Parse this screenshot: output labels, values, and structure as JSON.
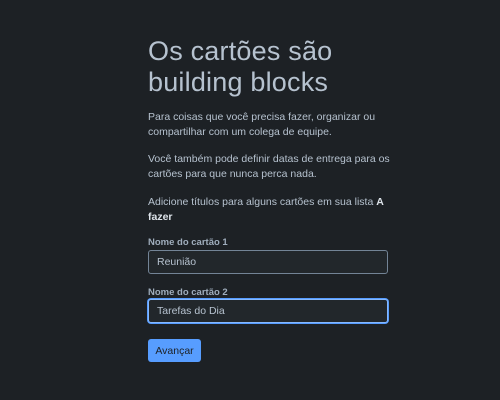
{
  "heading": "Os cartões são building blocks",
  "paragraphs": {
    "p1": "Para coisas que você precisa fazer, organizar ou compartilhar com um colega de equipe.",
    "p2": "Você também pode definir datas de entrega para os cartões para que nunca perca nada.",
    "p3_text": "Adicione títulos para alguns cartões em sua lista ",
    "p3_strong": "A fazer"
  },
  "fields": [
    {
      "label": "Nome do cartão 1",
      "value": "Reunião",
      "focused": false
    },
    {
      "label": "Nome do cartão 2",
      "value": "Tarefas do Dia",
      "focused": true
    }
  ],
  "button": {
    "label": "Avançar"
  },
  "colors": {
    "background": "#1d2125",
    "text": "#b6c2cf",
    "accent": "#579dff",
    "input_border": "#738496",
    "input_focus_border": "#85b8ff"
  }
}
